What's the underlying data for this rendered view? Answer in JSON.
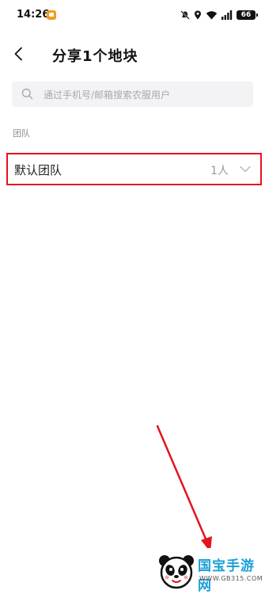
{
  "status_bar": {
    "time": "14:26",
    "battery": "66",
    "icons": [
      "app-notification-icon",
      "mute-icon",
      "location-icon",
      "wifi-icon",
      "signal-icon",
      "battery-icon"
    ]
  },
  "header": {
    "title": "分享1个地块",
    "back_icon": "chevron-left-icon"
  },
  "search": {
    "placeholder": "通过手机号/邮箱搜索农服用户",
    "value": ""
  },
  "section": {
    "label": "团队"
  },
  "teams": [
    {
      "name": "默认团队",
      "count": "1人",
      "expanded": false
    }
  ],
  "watermark": {
    "brand": "国宝手游网",
    "url": "WWW.GB315.COM"
  },
  "colors": {
    "highlight": "#e4141c",
    "search_bg": "#f3f3f5",
    "muted_text": "#9a9a9f",
    "watermark_blue": "#1aa0d8"
  }
}
